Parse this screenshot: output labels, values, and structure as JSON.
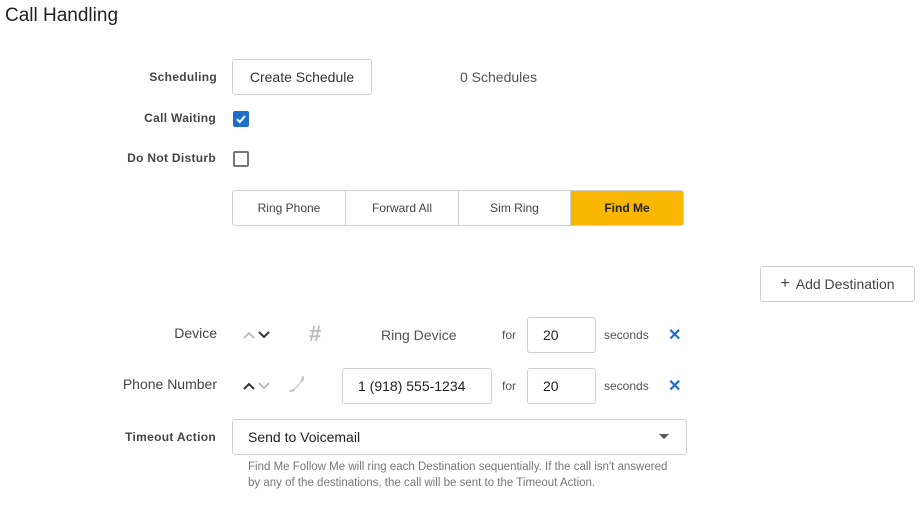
{
  "page": {
    "title": "Call Handling"
  },
  "scheduling": {
    "label": "Scheduling",
    "button": "Create Schedule",
    "count": "0 Schedules"
  },
  "call_waiting": {
    "label": "Call Waiting",
    "checked": true
  },
  "do_not_disturb": {
    "label": "Do Not Disturb",
    "checked": false
  },
  "modes": {
    "items": [
      "Ring Phone",
      "Forward All",
      "Sim Ring",
      "Find Me"
    ],
    "active": "Find Me"
  },
  "add_destination": {
    "label": "Add Destination",
    "icon": "plus-icon"
  },
  "destinations": [
    {
      "type_label": "Device",
      "icon": "hash-icon",
      "target": "Ring Device",
      "for": "for",
      "seconds": "20",
      "unit": "seconds"
    },
    {
      "type_label": "Phone Number",
      "icon": "phone-icon",
      "target": "1 (918) 555-1234",
      "for": "for",
      "seconds": "20",
      "unit": "seconds"
    }
  ],
  "timeout_action": {
    "label": "Timeout Action",
    "value": "Send to Voicemail",
    "help": "Find Me Follow Me will ring each Destination sequentially. If the call isn't answered by any of the destinations, the call will be sent to the Timeout Action."
  },
  "colors": {
    "accent": "#f9b700",
    "link": "#1e6fc9"
  }
}
